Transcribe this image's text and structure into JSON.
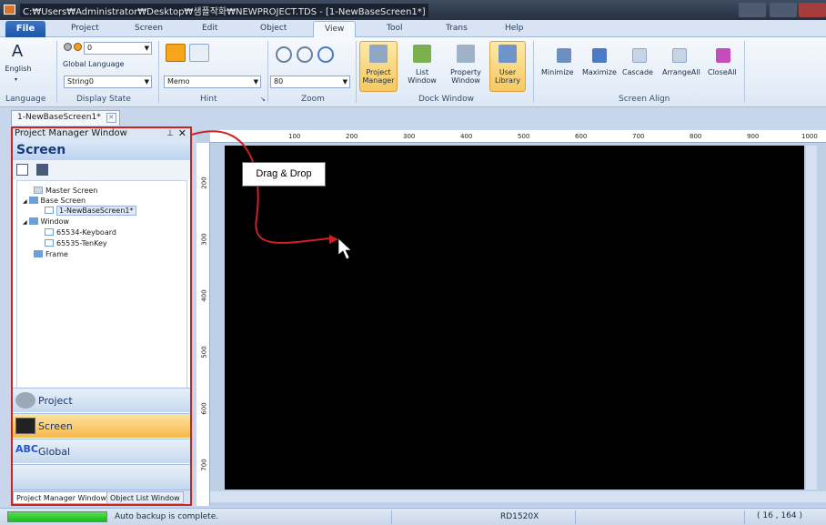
{
  "window": {
    "title": "C:₩Users₩Administrator₩Desktop₩샘플작화₩NEWPROJECT.TDS - [1-NewBaseScreen1*]"
  },
  "menu_tabs": [
    "Project",
    "Screen",
    "Edit",
    "Object",
    "View",
    "Tool",
    "Trans",
    "Help"
  ],
  "file_tab": "File",
  "active_tab": "View",
  "ribbon": {
    "language": {
      "button_label": "English",
      "group_label": "Language",
      "icon_glyph": "A"
    },
    "display_state": {
      "state_value": "0",
      "global_language_label": "Global Language",
      "string_value": "String0",
      "group_label": "Display State"
    },
    "hint": {
      "combo_value": "Memo",
      "group_label": "Hint"
    },
    "zoom": {
      "value": "80",
      "group_label": "Zoom"
    },
    "dock_window": {
      "buttons": [
        {
          "label": "Project Manager"
        },
        {
          "label": "List Window"
        },
        {
          "label": "Property Window"
        },
        {
          "label": "User Library"
        }
      ],
      "group_label": "Dock Window"
    },
    "screen_align": {
      "buttons": [
        "Minimize",
        "Maximize",
        "Cascade",
        "ArrangeAll",
        "CloseAll"
      ],
      "group_label": "Screen Align"
    }
  },
  "document_tab": {
    "label": "1-NewBaseScreen1*"
  },
  "project_manager": {
    "title": "Project Manager Window",
    "section_header": "Screen",
    "tree": [
      {
        "label": "Master Screen"
      },
      {
        "label": "Base Screen"
      },
      {
        "label": "1-NewBaseScreen1*"
      },
      {
        "label": "Window"
      },
      {
        "label": "65534-Keyboard"
      },
      {
        "label": "65535-TenKey"
      },
      {
        "label": "Frame"
      }
    ],
    "nav_buttons": [
      {
        "label": "Project"
      },
      {
        "label": "Screen"
      },
      {
        "label": "Global"
      }
    ],
    "bottom_tabs": [
      "Project Manager Window",
      "Object List Window"
    ]
  },
  "ruler": {
    "horizontal": [
      "100",
      "200",
      "300",
      "400",
      "500",
      "600",
      "700",
      "800",
      "900",
      "1000"
    ],
    "vertical": [
      "200",
      "300",
      "400",
      "500",
      "600",
      "700"
    ]
  },
  "callout": {
    "text": "Drag & Drop"
  },
  "statusbar": {
    "message": "Auto backup is complete.",
    "device": "RD1520X",
    "coordinates": "( 16 , 164 )"
  },
  "colors": {
    "canvas": "#000000",
    "highlight_border": "#cc2222",
    "accent_orange": "#f5b84a",
    "file_tab": "#1e55a8"
  }
}
